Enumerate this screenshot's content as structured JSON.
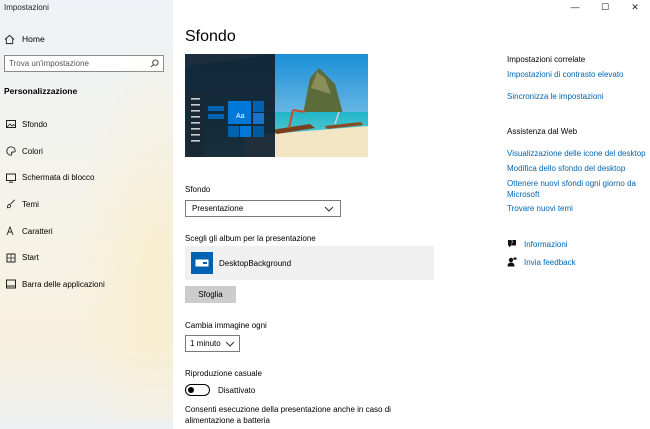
{
  "window": {
    "title": "Impostazioni",
    "minimize": "—",
    "maximize": "☐",
    "close": "✕"
  },
  "sidebar": {
    "home": "Home",
    "search_placeholder": "Trova un'impostazione",
    "section": "Personalizzazione",
    "items": [
      {
        "label": "Sfondo",
        "icon": "picture-icon"
      },
      {
        "label": "Colori",
        "icon": "palette-icon"
      },
      {
        "label": "Schermata di blocco",
        "icon": "lock-screen-icon"
      },
      {
        "label": "Temi",
        "icon": "brush-icon"
      },
      {
        "label": "Caratteri",
        "icon": "font-icon"
      },
      {
        "label": "Start",
        "icon": "start-icon"
      },
      {
        "label": "Barra delle applicazioni",
        "icon": "taskbar-icon"
      }
    ]
  },
  "main": {
    "title": "Sfondo",
    "preview_tile_text": "Aa",
    "background_label": "Sfondo",
    "background_value": "Presentazione",
    "albums_label": "Scegli gli album per la presentazione",
    "album_name": "DesktopBackground",
    "browse_button": "Sfoglia",
    "change_every_label": "Cambia immagine ogni",
    "change_every_value": "1 minuto",
    "shuffle_label": "Riproduzione casuale",
    "shuffle_state": "Disattivato",
    "battery_label_1": "Consenti esecuzione della presentazione anche in caso di",
    "battery_label_2": "alimentazione a batteria"
  },
  "related": {
    "heading": "Impostazioni correlate",
    "links": [
      "Impostazioni di contrasto elevato",
      "Sincronizza le impostazioni"
    ]
  },
  "help": {
    "heading": "Assistenza dal Web",
    "links": [
      "Visualizzazione delle icone del desktop",
      "Modifica dello sfondo del desktop",
      "Ottenere nuovi sfondi ogni giorno da",
      "Microsoft",
      "Trovare nuovi temi"
    ],
    "info": "Informazioni",
    "feedback": "Invia feedback"
  },
  "colors": {
    "accent": "#0063b1",
    "link": "#0066b4"
  }
}
